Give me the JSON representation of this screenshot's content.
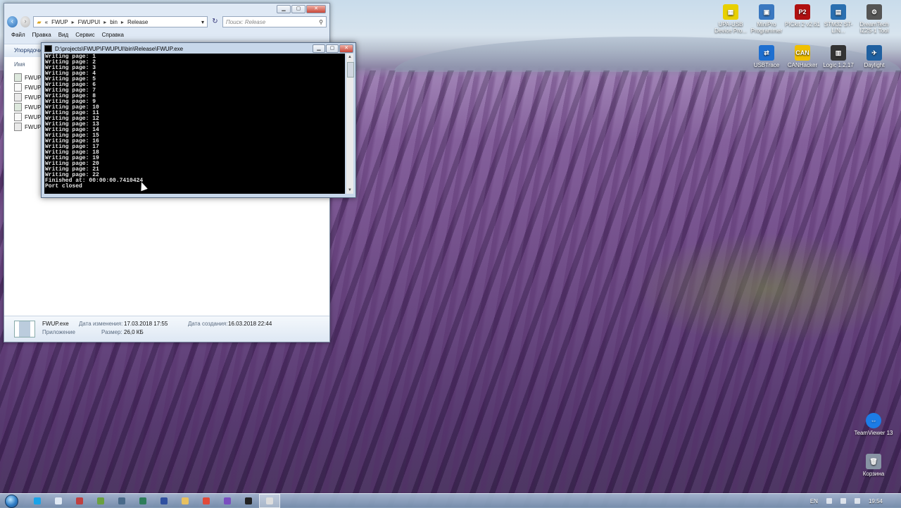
{
  "desktop": {
    "icons": [
      {
        "label": "UPA-USB Device Pro...",
        "glyph": "▦",
        "color": "#e8d000"
      },
      {
        "label": "MiniPro Programmer",
        "glyph": "▣",
        "color": "#3a78c0"
      },
      {
        "label": "PICkit 2 v2.61",
        "glyph": "P2",
        "color": "#b01010"
      },
      {
        "label": "STM32 ST-LIN...",
        "glyph": "▤",
        "color": "#2a6fb0"
      },
      {
        "label": "DreamTech IZ2S-1 Tool",
        "glyph": "⚙",
        "color": "#555555"
      },
      {
        "label": "USBTrace",
        "glyph": "⇄",
        "color": "#1e6fd0"
      },
      {
        "label": "CANHacker",
        "glyph": "CAN",
        "color": "#f0c000"
      },
      {
        "label": "Logic 1.2.17",
        "glyph": "▥",
        "color": "#333333"
      },
      {
        "label": "Daylight",
        "glyph": "✈",
        "color": "#2060a0"
      },
      {
        "label": "TeamViewer 13",
        "glyph": "⇔",
        "color": "#1c7ce6"
      },
      {
        "label": "Корзина",
        "glyph": "🗑",
        "color": "#8894a4"
      }
    ]
  },
  "explorer": {
    "address": {
      "prefix": "«",
      "segments": [
        "FWUP",
        "FWUPUI",
        "bin",
        "Release"
      ]
    },
    "search_placeholder": "Поиск: Release",
    "menu": [
      "Файл",
      "Правка",
      "Вид",
      "Сервис",
      "Справка"
    ],
    "toolbar_label": "Упорядочи",
    "column_name": "Имя",
    "files": [
      "FWUP.",
      "FWUP.",
      "FWUP.",
      "FWUPL",
      "FWUPL",
      "FWUPL"
    ],
    "details": {
      "name": "FWUP.exe",
      "type": "Приложение",
      "modified_label": "Дата изменения:",
      "modified_value": "17.03.2018 17:55",
      "size_label": "Размер:",
      "size_value": "26,0 КБ",
      "created_label": "Дата создания:",
      "created_value": "16.03.2018 22:44"
    }
  },
  "console": {
    "title": "D:\\projects\\FWUP\\FWUPUI\\bin\\Release\\FWUP.exe",
    "lines": [
      "Writing page: 1",
      "Writing page: 2",
      "Writing page: 3",
      "Writing page: 4",
      "Writing page: 5",
      "Writing page: 6",
      "Writing page: 7",
      "Writing page: 8",
      "Writing page: 9",
      "Writing page: 10",
      "Writing page: 11",
      "Writing page: 12",
      "Writing page: 13",
      "Writing page: 14",
      "Writing page: 15",
      "Writing page: 16",
      "Writing page: 17",
      "Writing page: 18",
      "Writing page: 19",
      "Writing page: 20",
      "Writing page: 21",
      "Writing page: 22",
      "Finished at: 00:00:00.7410424",
      "Port closed"
    ]
  },
  "taskbar": {
    "items": [
      {
        "name": "skype",
        "color": "#1aa3e8"
      },
      {
        "name": "explorer-blank",
        "color": "#dfe8f3"
      },
      {
        "name": "tool-red",
        "color": "#c04040"
      },
      {
        "name": "tool-green",
        "color": "#6aa040"
      },
      {
        "name": "tool-chip",
        "color": "#4a6a8a"
      },
      {
        "name": "tool-board",
        "color": "#2e7d5a"
      },
      {
        "name": "tool-save",
        "color": "#3050a0"
      },
      {
        "name": "folder",
        "color": "#e8c060"
      },
      {
        "name": "chrome",
        "color": "#e04a3a"
      },
      {
        "name": "visual-studio",
        "color": "#7a4ec0"
      },
      {
        "name": "app-dark",
        "color": "#222222"
      },
      {
        "name": "console",
        "color": "#dddddd"
      }
    ],
    "language": "EN",
    "clock": "19:54"
  }
}
